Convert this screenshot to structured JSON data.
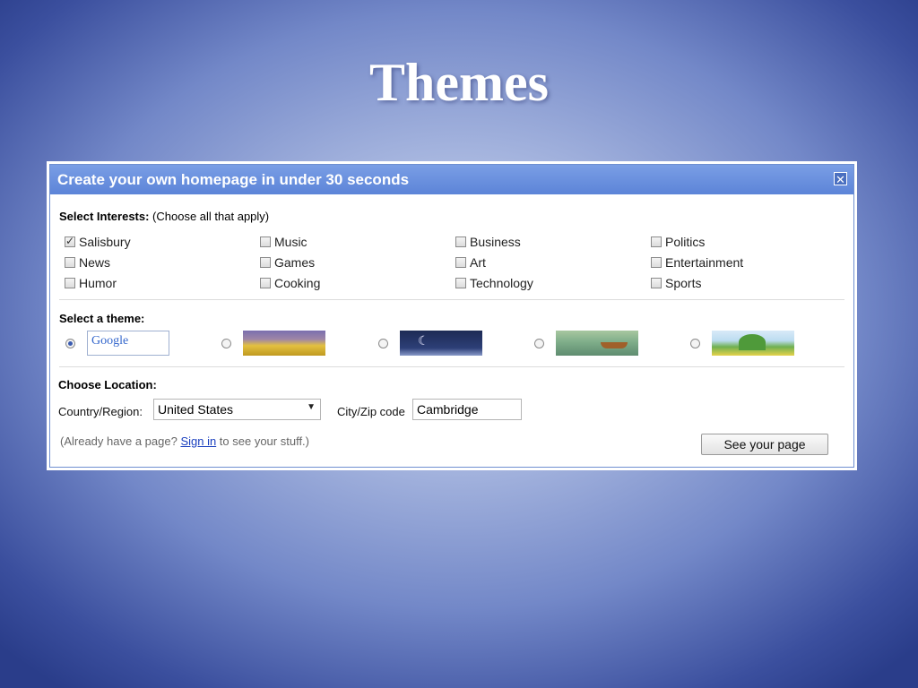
{
  "slide": {
    "title": "Themes"
  },
  "dialog": {
    "title": "Create your own homepage in under 30 seconds",
    "close_symbol": "✕",
    "interests": {
      "label": "Select Interests:",
      "hint": " (Choose all that apply)",
      "items": [
        {
          "label": "Salisbury",
          "checked": true
        },
        {
          "label": "Music",
          "checked": false
        },
        {
          "label": "Business",
          "checked": false
        },
        {
          "label": "Politics",
          "checked": false
        },
        {
          "label": "News",
          "checked": false
        },
        {
          "label": "Games",
          "checked": false
        },
        {
          "label": "Art",
          "checked": false
        },
        {
          "label": "Entertainment",
          "checked": false
        },
        {
          "label": "Humor",
          "checked": false
        },
        {
          "label": "Cooking",
          "checked": false
        },
        {
          "label": "Technology",
          "checked": false
        },
        {
          "label": "Sports",
          "checked": false
        }
      ]
    },
    "theme": {
      "label": "Select a theme:",
      "options": [
        {
          "name": "classic",
          "text": "Google",
          "selected": true
        },
        {
          "name": "sunset",
          "selected": false
        },
        {
          "name": "night",
          "selected": false
        },
        {
          "name": "river",
          "selected": false
        },
        {
          "name": "hills",
          "selected": false
        }
      ]
    },
    "location": {
      "label": "Choose Location:",
      "country_label": "Country/Region:",
      "country_value": "United States",
      "city_label": "City/Zip code",
      "city_value": "Cambridge"
    },
    "footer": {
      "pre": "(Already have a page? ",
      "link": "Sign in",
      "post": " to see your stuff.)",
      "button": "See your page"
    }
  }
}
